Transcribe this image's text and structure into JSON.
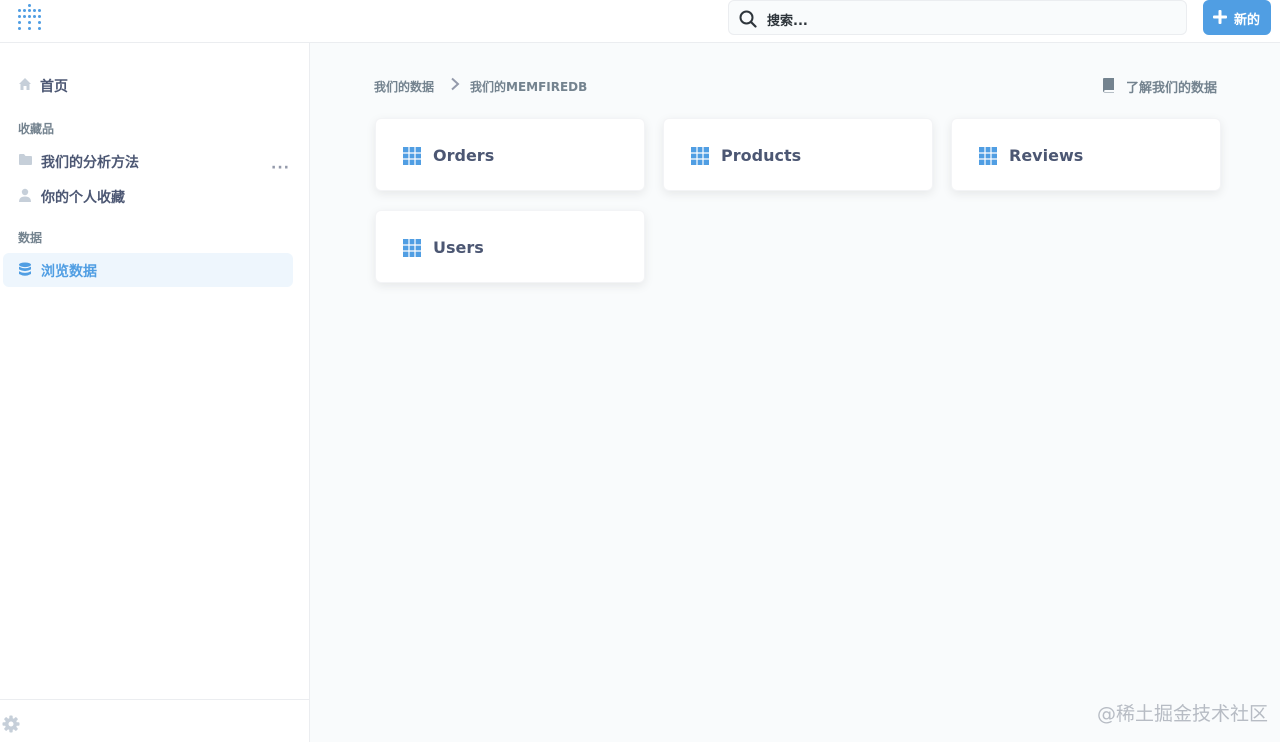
{
  "header": {
    "search_placeholder": "搜索...",
    "new_label": "新的"
  },
  "sidebar": {
    "home_label": "首页",
    "favorites_title": "收藏品",
    "more_label": "···",
    "items": [
      {
        "label": "我们的分析方法",
        "icon": "folder-icon"
      },
      {
        "label": "你的个人收藏",
        "icon": "person-icon"
      }
    ],
    "data_title": "数据",
    "browse_label": "浏览数据"
  },
  "main": {
    "breadcrumb": {
      "root": "我们的数据",
      "current": "我们的MEMFIREDB"
    },
    "learn_label": "了解我们的数据",
    "tables": [
      {
        "name": "Orders"
      },
      {
        "name": "Products"
      },
      {
        "name": "Reviews"
      },
      {
        "name": "Users"
      }
    ]
  },
  "watermark": "@稀土掘金技术社区",
  "colors": {
    "brand": "#509ee3",
    "text": "#4c5773",
    "muted": "#74838f"
  }
}
